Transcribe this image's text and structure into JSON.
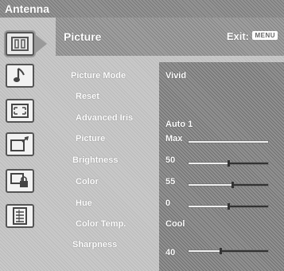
{
  "topbar": {
    "source": "Antenna"
  },
  "header": {
    "title": "Picture",
    "exit_label": "Exit:",
    "menu_key": "MENU"
  },
  "settings": [
    {
      "label": "Picture Mode",
      "value": "Vivid"
    },
    {
      "label": "Reset",
      "value": ""
    },
    {
      "label": "Advanced Iris",
      "value": "Auto 1"
    },
    {
      "label": "Picture",
      "value": "Max",
      "level": 1.0
    },
    {
      "label": "Brightness",
      "value": "50",
      "level": 0.5
    },
    {
      "label": "Color",
      "value": "55",
      "level": 0.55
    },
    {
      "label": "Hue",
      "value": "0",
      "level": 0.5
    },
    {
      "label": "Color Temp.",
      "value": "Cool"
    },
    {
      "label": "Sharpness",
      "value": "40",
      "level": 0.4
    }
  ],
  "sidebar_icons": [
    "picture-settings-icon",
    "sound-icon",
    "screen-icon",
    "setup-icon",
    "lock-icon",
    "channel-list-icon"
  ],
  "colors": {
    "panel": "#8a8a8a",
    "background": "#c9c9c9",
    "text": "#ffffff"
  }
}
